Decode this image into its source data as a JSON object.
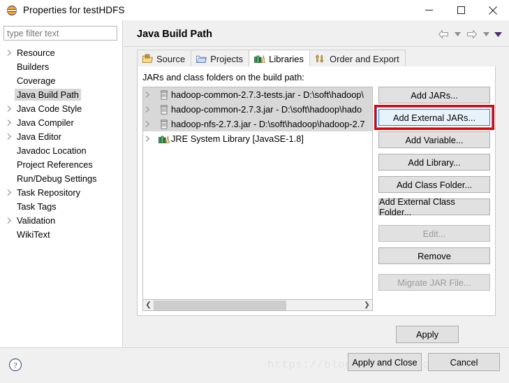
{
  "window": {
    "title": "Properties for testHDFS",
    "app_icon": "eclipse-icon",
    "minimize_label": "—",
    "maximize_label": "□",
    "close_label": "✕"
  },
  "sidebar": {
    "filter": {
      "value": "",
      "placeholder": "type filter text"
    },
    "items": [
      {
        "label": "Resource",
        "expandable": true,
        "selected": false
      },
      {
        "label": "Builders",
        "expandable": false,
        "selected": false
      },
      {
        "label": "Coverage",
        "expandable": false,
        "selected": false
      },
      {
        "label": "Java Build Path",
        "expandable": false,
        "selected": true
      },
      {
        "label": "Java Code Style",
        "expandable": true,
        "selected": false
      },
      {
        "label": "Java Compiler",
        "expandable": true,
        "selected": false
      },
      {
        "label": "Java Editor",
        "expandable": true,
        "selected": false
      },
      {
        "label": "Javadoc Location",
        "expandable": false,
        "selected": false
      },
      {
        "label": "Project References",
        "expandable": false,
        "selected": false
      },
      {
        "label": "Run/Debug Settings",
        "expandable": false,
        "selected": false
      },
      {
        "label": "Task Repository",
        "expandable": true,
        "selected": false
      },
      {
        "label": "Task Tags",
        "expandable": false,
        "selected": false
      },
      {
        "label": "Validation",
        "expandable": true,
        "selected": false
      },
      {
        "label": "WikiText",
        "expandable": false,
        "selected": false
      }
    ]
  },
  "page": {
    "title": "Java Build Path",
    "nav": {
      "back_label": "back-arrow",
      "back_caret": "▼",
      "forward_label": "forward-arrow",
      "forward_caret": "▼",
      "menu_caret": "▼"
    },
    "tabs": [
      {
        "label": "Source",
        "icon": "source-folder-icon",
        "active": false
      },
      {
        "label": "Projects",
        "icon": "projects-folder-icon",
        "active": false
      },
      {
        "label": "Libraries",
        "icon": "libraries-books-icon",
        "active": true
      },
      {
        "label": "Order and Export",
        "icon": "order-export-arrows-icon",
        "active": false
      }
    ],
    "list_caption": "JARs and class folders on the build path:",
    "entries": [
      {
        "label": "hadoop-common-2.7.3-tests.jar - D:\\soft\\hadoop\\",
        "icon": "jar-icon",
        "selected": true
      },
      {
        "label": "hadoop-common-2.7.3.jar - D:\\soft\\hadoop\\hado",
        "icon": "jar-icon",
        "selected": true
      },
      {
        "label": "hadoop-nfs-2.7.3.jar - D:\\soft\\hadoop\\hadoop-2.7",
        "icon": "jar-icon",
        "selected": true
      },
      {
        "label": "JRE System Library [JavaSE-1.8]",
        "icon": "library-icon",
        "selected": false
      }
    ],
    "scrollbar": {
      "left_arrow": "❮",
      "right_arrow": "❯"
    },
    "buttons": [
      {
        "label": "Add JARs...",
        "enabled": true,
        "highlighted": false,
        "gap_before": false
      },
      {
        "label": "Add External JARs...",
        "enabled": true,
        "highlighted": true,
        "gap_before": false
      },
      {
        "label": "Add Variable...",
        "enabled": true,
        "highlighted": false,
        "gap_before": false
      },
      {
        "label": "Add Library...",
        "enabled": true,
        "highlighted": false,
        "gap_before": false
      },
      {
        "label": "Add Class Folder...",
        "enabled": true,
        "highlighted": false,
        "gap_before": false
      },
      {
        "label": "Add External Class Folder...",
        "enabled": true,
        "highlighted": false,
        "gap_before": false
      },
      {
        "label": "Edit...",
        "enabled": false,
        "highlighted": false,
        "gap_before": true
      },
      {
        "label": "Remove",
        "enabled": true,
        "highlighted": false,
        "gap_before": false
      },
      {
        "label": "Migrate JAR File...",
        "enabled": false,
        "highlighted": false,
        "gap_before": true
      }
    ],
    "apply_label": "Apply"
  },
  "footer": {
    "help_icon": "help-question-icon",
    "apply_and_close_label": "Apply and Close",
    "cancel_label": "Cancel",
    "watermark": "https://blog.csdn.net/qq_42881421"
  },
  "colors": {
    "accent": "#2a7fd4",
    "highlight_box": "#e60000",
    "selection": "#d8d8d8",
    "window_bg": "#f0f0f0"
  }
}
